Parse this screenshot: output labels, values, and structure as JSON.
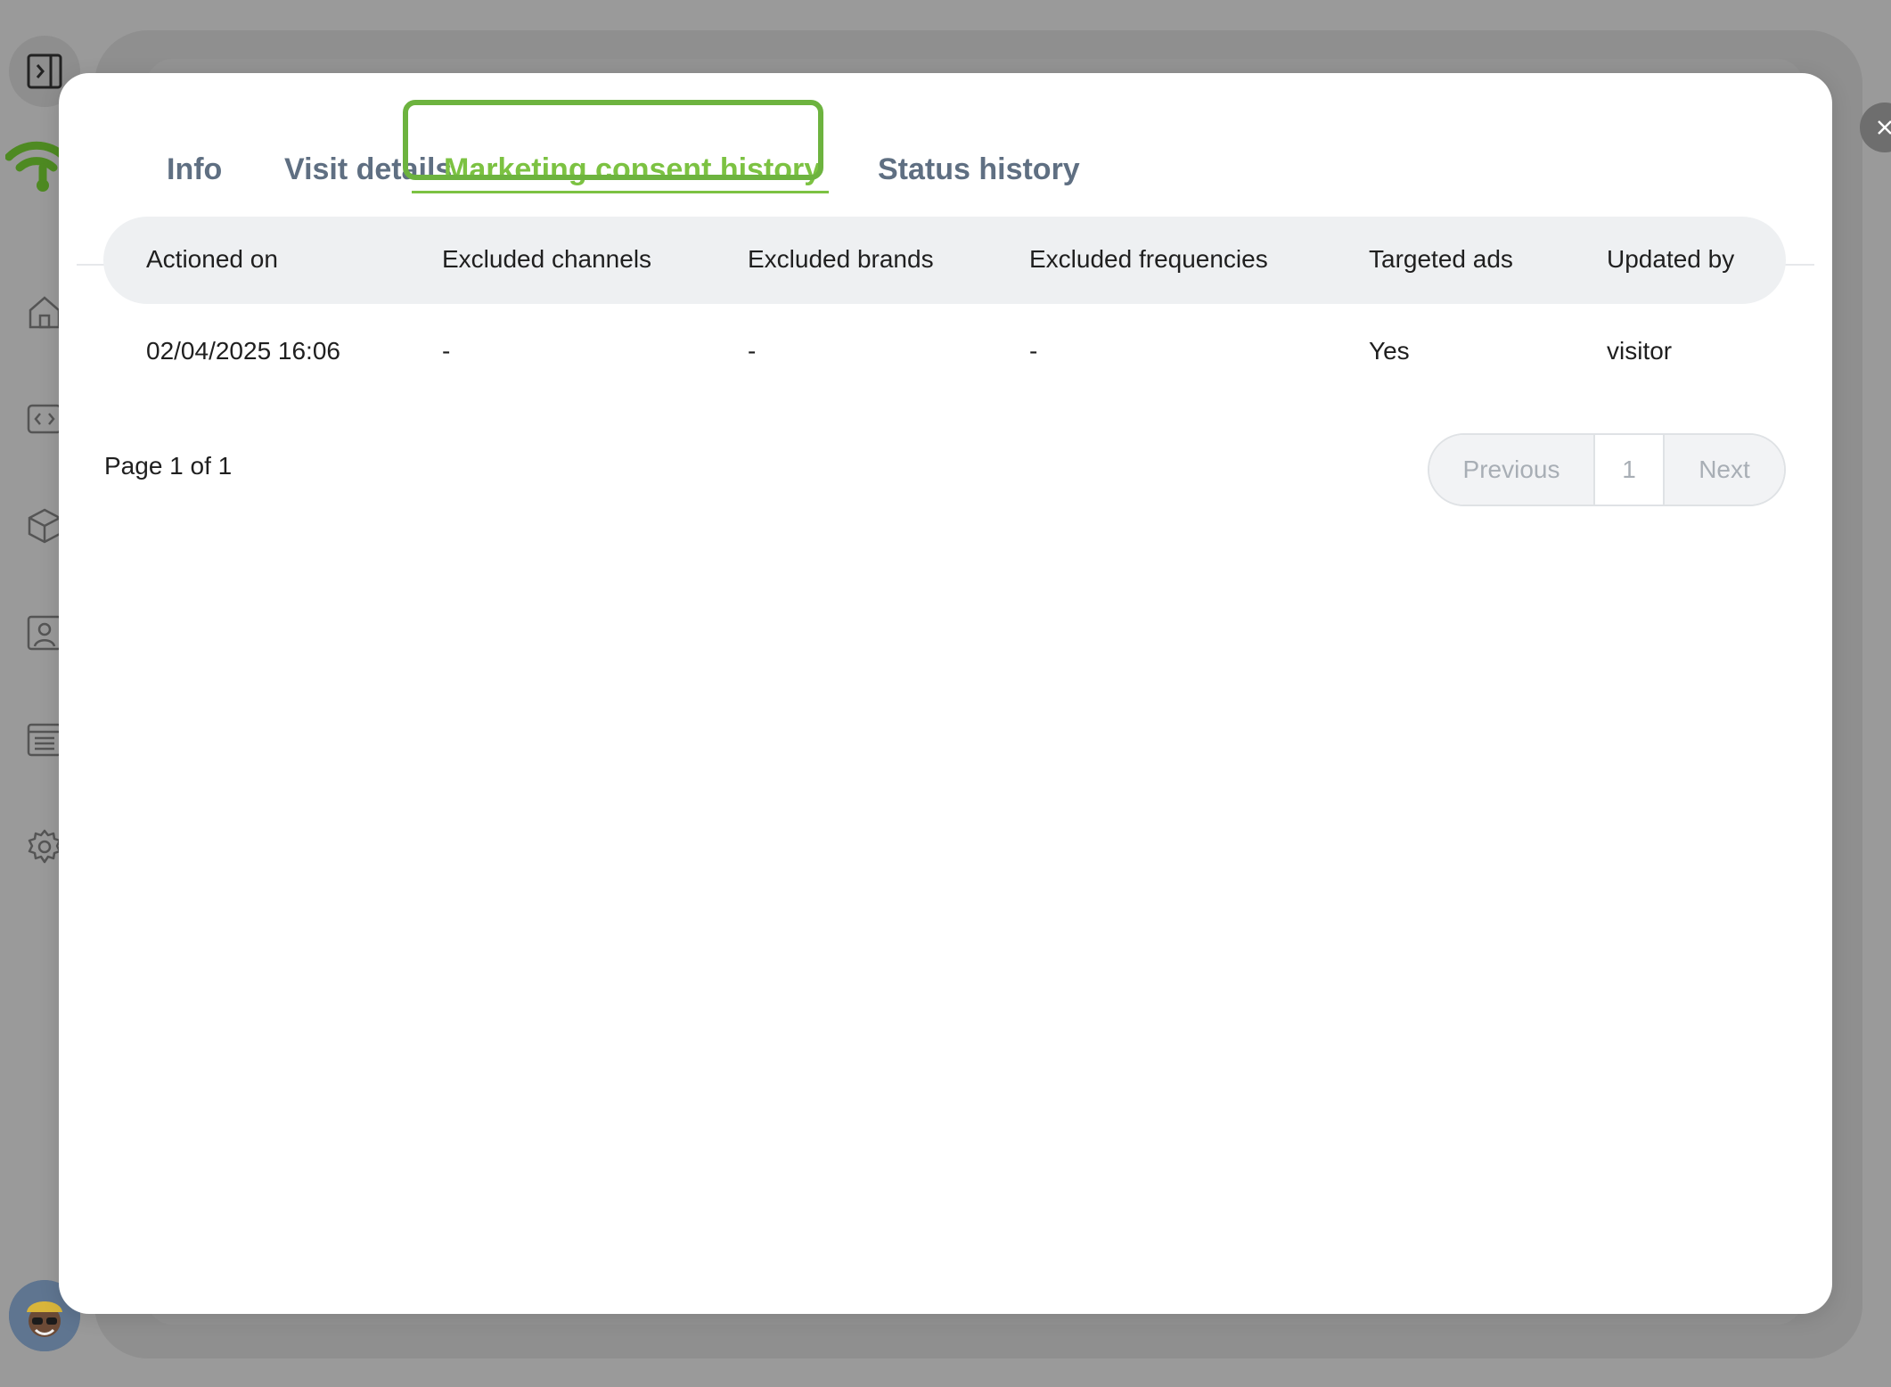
{
  "tabs": [
    {
      "label": "Info"
    },
    {
      "label": "Visit details"
    },
    {
      "label": "Marketing consent history"
    },
    {
      "label": "Status history"
    }
  ],
  "active_tab": "Marketing consent history",
  "table": {
    "columns": [
      "Actioned on",
      "Excluded channels",
      "Excluded brands",
      "Excluded frequencies",
      "Targeted ads",
      "Updated by"
    ],
    "rows": [
      [
        "02/04/2025 16:06",
        "-",
        "-",
        "-",
        "Yes",
        "visitor"
      ]
    ]
  },
  "pagination": {
    "info": "Page 1 of 1",
    "previous": "Previous",
    "page": "1",
    "next": "Next"
  },
  "colors": {
    "accent": "#7cc242",
    "tab_text": "#5f6f82",
    "header_bg": "#eef0f2"
  },
  "icons": {
    "sidebar": [
      "sidebar-toggle-icon",
      "wifi-logo-icon",
      "home-icon",
      "code-icon",
      "cube-icon",
      "contact-card-icon",
      "list-icon",
      "gear-icon"
    ],
    "close": "close-icon"
  }
}
